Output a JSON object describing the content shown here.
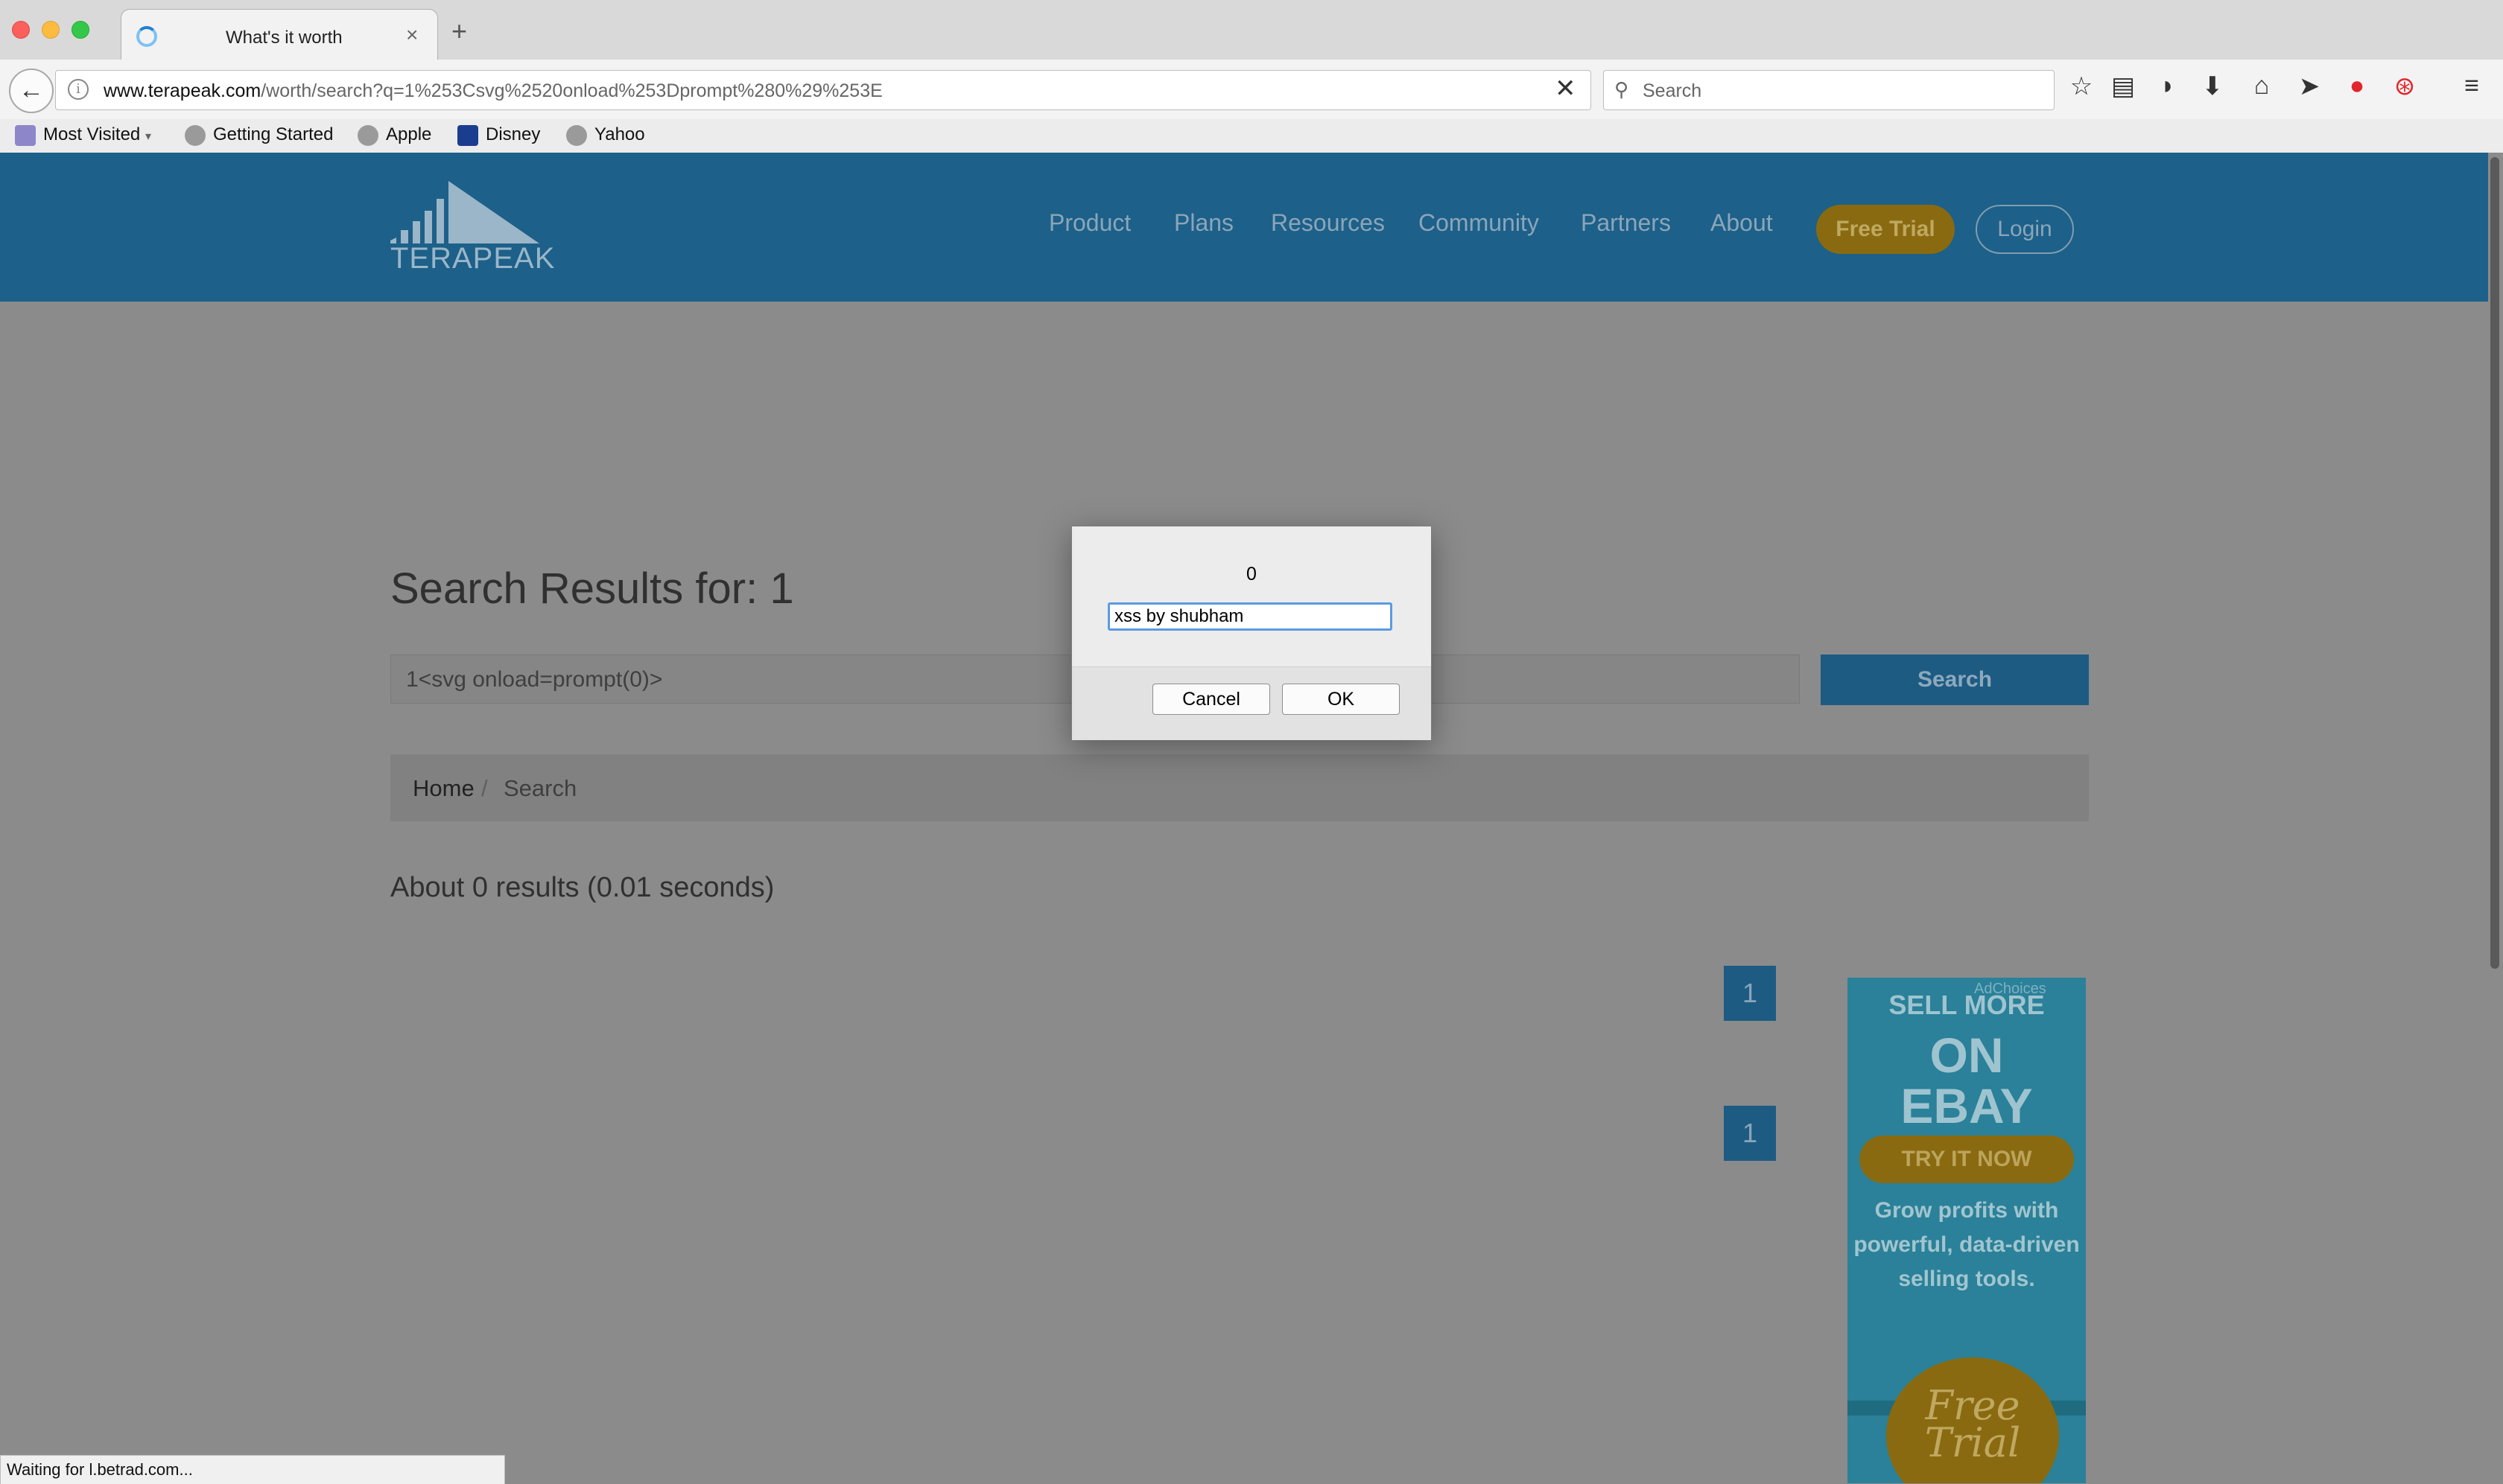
{
  "browser": {
    "tab_title": "What's it worth",
    "url_host": "www.terapeak.com",
    "url_path": "/worth/search?q=1%253Csvg%2520onload%253Dprompt%280%29%253E",
    "search_placeholder": "Search",
    "bookmarks": [
      "Most Visited",
      "Getting Started",
      "Apple",
      "Disney",
      "Yahoo"
    ],
    "status": "Waiting for l.betrad.com..."
  },
  "site": {
    "logo": "TERAPEAK",
    "nav": [
      "Product",
      "Plans",
      "Resources",
      "Community",
      "Partners",
      "About"
    ],
    "free_trial": "Free Trial",
    "login": "Login"
  },
  "main": {
    "title": "Search Results for: 1",
    "search_value": "1<svg onload=prompt(0)>",
    "search_button": "Search",
    "breadcrumb": {
      "home": "Home",
      "separator": "/",
      "current": "Search"
    },
    "results_count": "About 0 results  (0.01 seconds)",
    "pages": [
      "1",
      "1"
    ]
  },
  "ad": {
    "choices": "AdChoices",
    "line1": "SELL MORE",
    "line2": "ON",
    "line3": "EBAY",
    "cta": "TRY IT NOW",
    "body": "Grow profits with powerful, data-driven selling tools.",
    "badge_line1": "Free",
    "badge_line2": "Trial"
  },
  "dialog": {
    "message": "0",
    "input_value": "xss by shubham",
    "cancel": "Cancel",
    "ok": "OK"
  },
  "colors": {
    "header_blue": "#1d6089",
    "accent_gold": "#8a6a10",
    "overlay_gray": "#8b8b8b"
  }
}
